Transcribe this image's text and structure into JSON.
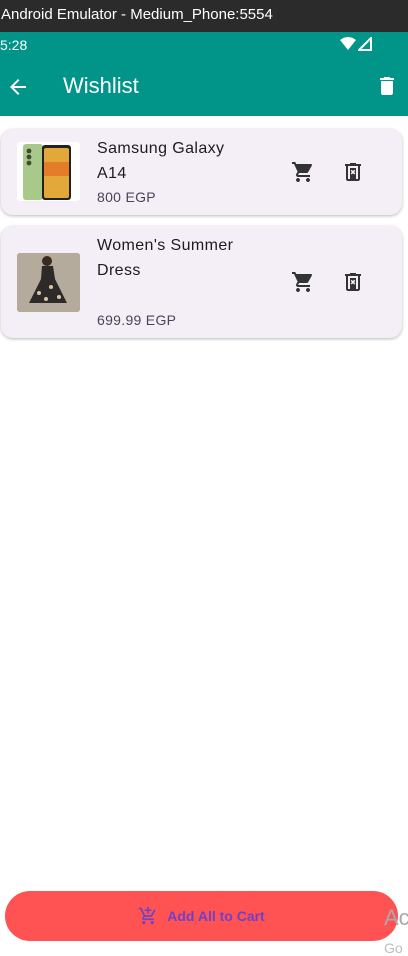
{
  "window": {
    "title": "Android Emulator - Medium_Phone:5554"
  },
  "status_bar": {
    "time": "5:28",
    "icons": [
      "wifi-icon",
      "signal-icon"
    ]
  },
  "app_bar": {
    "title": "Wishlist",
    "back_icon": "arrow-back-icon",
    "action_icon": "delete-icon"
  },
  "items": [
    {
      "name": "Samsung Galaxy A14",
      "price": "800 EGP",
      "image": "phone-product-image",
      "cart_icon": "shopping-cart-icon",
      "remove_icon": "remove-from-wishlist-icon"
    },
    {
      "name": "Women's Summer Dress",
      "price": "699.99 EGP",
      "image": "dress-product-image",
      "cart_icon": "shopping-cart-icon",
      "remove_icon": "remove-from-wishlist-icon"
    }
  ],
  "footer": {
    "button_label": "Add All to Cart",
    "button_icon": "add-shopping-cart-icon"
  },
  "watermark": {
    "line1": "Ac",
    "line2": "Go"
  },
  "colors": {
    "primary": "#019488",
    "card": "#f4eff6",
    "button": "#ff5252",
    "button_text": "#6f41c8"
  }
}
